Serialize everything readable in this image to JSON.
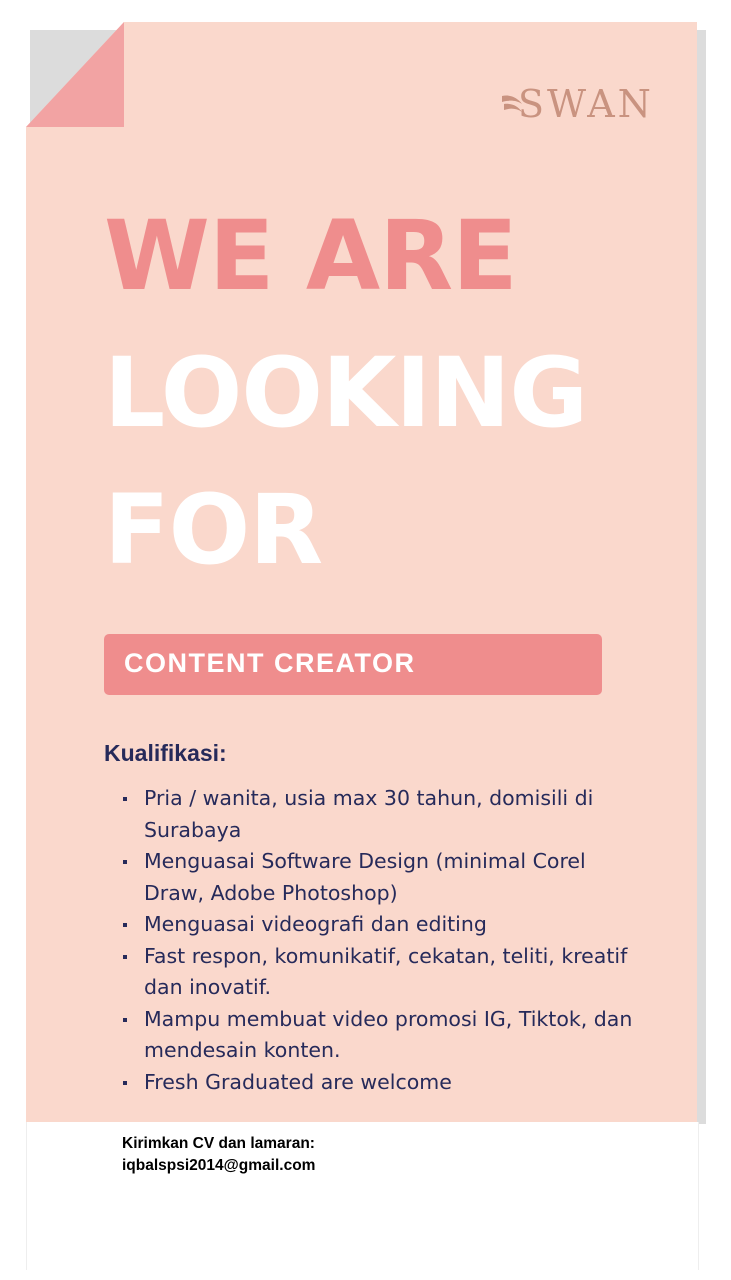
{
  "brand": {
    "logo_text": "SWAN"
  },
  "headline": {
    "line1": "WE ARE",
    "line2": "LOOKING",
    "line3": "FOR"
  },
  "role": "CONTENT CREATOR",
  "qualifications": {
    "title": "Kualifikasi:",
    "items": [
      "Pria / wanita, usia max 30 tahun, domisili di Surabaya",
      "Menguasai Software Design (minimal Corel Draw, Adobe Photoshop)",
      "Menguasai videografi dan editing",
      "Fast respon,  komunikatif, cekatan, teliti, kreatif dan inovatif.",
      "Mampu membuat video promosi IG, Tiktok, dan mendesain konten.",
      "Fresh Graduated are welcome"
    ]
  },
  "contact": {
    "instruction": "Kirimkan CV dan lamaran:",
    "email": "iqbalspsi2014@gmail.com"
  },
  "colors": {
    "paper": "#fad8cc",
    "accent_pink": "#ef8d8d",
    "fold": "#f2a3a3",
    "text_navy": "#262a5a",
    "logo": "#c99380"
  }
}
